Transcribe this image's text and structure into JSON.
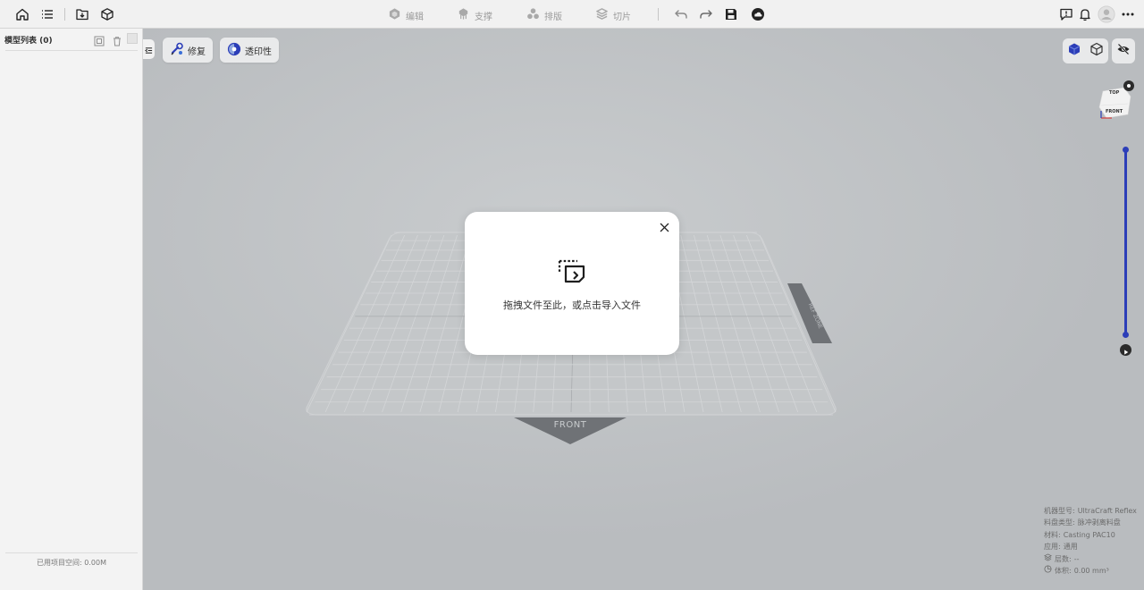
{
  "toolbar": {
    "left_icons": [
      "home-icon",
      "list-icon",
      "import-icon",
      "model-cube-icon"
    ],
    "modes": [
      {
        "label": "编辑",
        "icon": "edit-mode-icon"
      },
      {
        "label": "支撑",
        "icon": "support-mode-icon"
      },
      {
        "label": "排版",
        "icon": "layout-mode-icon"
      },
      {
        "label": "切片",
        "icon": "slice-mode-icon"
      }
    ],
    "actions": [
      "undo-icon",
      "redo-icon",
      "save-icon",
      "cloud-icon"
    ],
    "right_icons": [
      "feedback-icon",
      "bell-icon",
      "avatar",
      "more-icon"
    ]
  },
  "left_panel": {
    "title": "模型列表 (0)",
    "footer": "已用项目空间: 0.00M"
  },
  "viewport": {
    "repair_label": "修复",
    "transmittance_label": "透印性",
    "platform_front_label": "FRONT",
    "platform_side_label": "REF ZONE",
    "navcube_top": "TOP",
    "navcube_front": "FRONT",
    "accent_color": "#2c3eb8"
  },
  "info": {
    "machine_label": "机器型号:",
    "machine_value": "UltraCraft Reflex",
    "tray_label": "料盘类型:",
    "tray_value": "脉冲剥离料盘",
    "material_label": "材料:",
    "material_value": "Casting PAC10",
    "usage_label": "应用:",
    "usage_value": "通用",
    "layers_label": "层数:",
    "layers_value": "--",
    "volume_label": "体积:",
    "volume_value": "0.00 mm³"
  },
  "modal": {
    "message": "拖拽文件至此，或点击导入文件"
  }
}
